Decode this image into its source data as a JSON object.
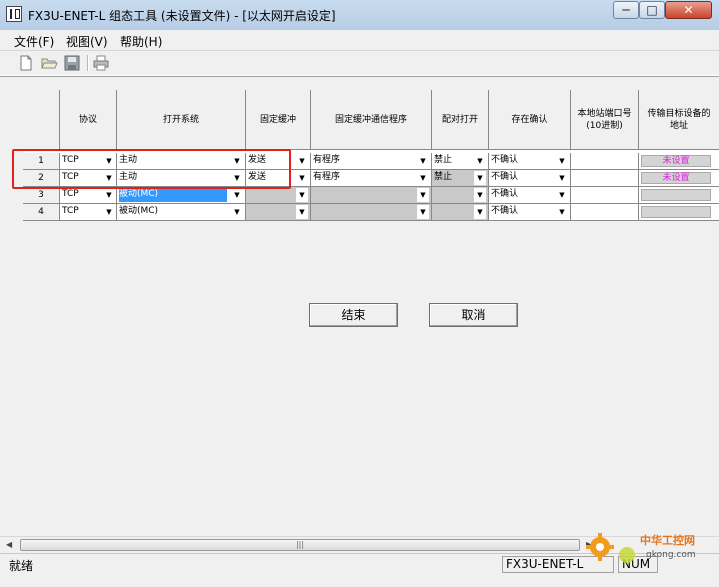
{
  "window": {
    "title": "FX3U-ENET-L 组态工具 (未设置文件) - [以太网开启设定]",
    "minimize_glyph": "─",
    "maximize_glyph": "□",
    "close_glyph": "✕"
  },
  "menu": {
    "file": "文件(F)",
    "view": "视图(V)",
    "help": "帮助(H)"
  },
  "toolbar": {
    "icons": [
      "new-file-icon",
      "open-folder-icon",
      "save-disk-icon",
      "print-icon"
    ]
  },
  "table": {
    "headers": {
      "protocol": "协议",
      "open_system": "打开系统",
      "fixed_buffer": "固定缓冲",
      "fixed_buffer_comm": "固定缓冲通信程序",
      "pair_open": "配对打开",
      "existence_confirm": "存在确认",
      "local_port_line1": "本地站端口号",
      "local_port_line2": "(10进制)",
      "dest_addr_line1": "传输目标设备的",
      "dest_addr_line2": "地址"
    },
    "rows": [
      {
        "num": "1",
        "protocol": "TCP",
        "open_system": "主动",
        "fixed_buffer": "发送",
        "fixed_buffer_comm": "有程序",
        "pair_open": "禁止",
        "existence_confirm": "不确认",
        "local_port": "",
        "dest_addr": "未设置"
      },
      {
        "num": "2",
        "protocol": "TCP",
        "open_system": "主动",
        "fixed_buffer": "发送",
        "fixed_buffer_comm": "有程序",
        "pair_open": "禁止",
        "existence_confirm": "不确认",
        "local_port": "",
        "dest_addr": "未设置"
      },
      {
        "num": "3",
        "protocol": "TCP",
        "open_system": "被动(MC)",
        "fixed_buffer": "",
        "fixed_buffer_comm": "",
        "pair_open": "",
        "existence_confirm": "不确认",
        "local_port": "",
        "dest_addr": ""
      },
      {
        "num": "4",
        "protocol": "TCP",
        "open_system": "被动(MC)",
        "fixed_buffer": "",
        "fixed_buffer_comm": "",
        "pair_open": "",
        "existence_confirm": "不确认",
        "local_port": "",
        "dest_addr": ""
      }
    ]
  },
  "buttons": {
    "end": "结束",
    "cancel": "取消"
  },
  "scrollbar": {
    "left_arrow": "◀",
    "right_arrow": "▶",
    "grip": "|||"
  },
  "status": {
    "text": "就绪",
    "module": "FX3U-ENET-L",
    "num": "NUM"
  },
  "watermark": {
    "line1": "中华工控网",
    "line2": "gkong.com"
  },
  "colors": {
    "highlight_box": "#e0211c",
    "selection": "#3399ff",
    "unset_text": "#e020e0"
  }
}
